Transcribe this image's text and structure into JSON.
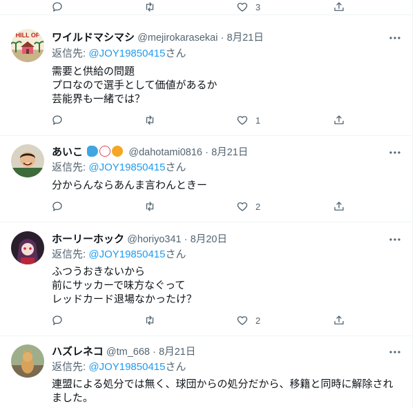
{
  "top_actions": {
    "likes": "3"
  },
  "tweets": [
    {
      "name": "ワイルドマシマシ",
      "handle": "@mejirokarasekai",
      "date": "8月21日",
      "reply_label": "返信先:",
      "reply_mention": "@JOY19850415",
      "reply_suffix": "さん",
      "lines": [
        "需要と供給の問題",
        "プロなので選手として価値があるか",
        "芸能界も一緒では？"
      ],
      "likes": "1",
      "avatar_logo": "HILL OF"
    },
    {
      "name": "あいこ",
      "handle": "@dahotami0816",
      "date": "8月21日",
      "reply_label": "返信先:",
      "reply_mention": "@JOY19850415",
      "reply_suffix": "さん",
      "lines": [
        "分からんならあんま言わんときー"
      ],
      "likes": "2"
    },
    {
      "name": "ホーリーホック",
      "handle": "@horiyo341",
      "date": "8月20日",
      "reply_label": "返信先:",
      "reply_mention": "@JOY19850415",
      "reply_suffix": "さん",
      "lines": [
        "ふつうおきないから",
        "前にサッカーで味方なぐって",
        "レッドカード退場なかったけ？"
      ],
      "likes": "2"
    },
    {
      "name": "ハズレネコ",
      "handle": "@tm_668",
      "date": "8月21日",
      "reply_label": "返信先:",
      "reply_mention": "@JOY19850415",
      "reply_suffix": "さん",
      "lines": [
        "連盟による処分では無く、球団からの処分だから、移籍と同時に解除され",
        "ました。"
      ]
    }
  ],
  "separator": "·",
  "colors": {
    "accent": "#1d9bf0",
    "secondary_text": "#536471",
    "text": "#0f1419",
    "divider": "#eff3f4"
  }
}
